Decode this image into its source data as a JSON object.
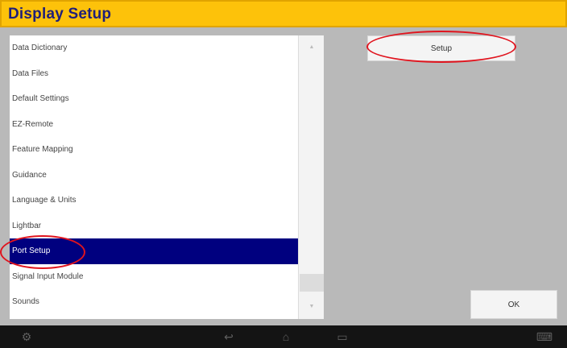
{
  "window": {
    "title": "Display Setup"
  },
  "list": {
    "items": [
      {
        "label": "Data Dictionary",
        "selected": false
      },
      {
        "label": "Data Files",
        "selected": false
      },
      {
        "label": "Default Settings",
        "selected": false
      },
      {
        "label": "EZ-Remote",
        "selected": false
      },
      {
        "label": "Feature Mapping",
        "selected": false
      },
      {
        "label": "Guidance",
        "selected": false
      },
      {
        "label": "Language & Units",
        "selected": false
      },
      {
        "label": "Lightbar",
        "selected": false
      },
      {
        "label": "Port Setup",
        "selected": true
      },
      {
        "label": "Signal Input Module",
        "selected": false
      },
      {
        "label": "Sounds",
        "selected": false
      }
    ],
    "scroll_up_icon": "triangle-up-icon",
    "scroll_down_icon": "triangle-down-icon"
  },
  "buttons": {
    "setup_label": "Setup",
    "ok_label": "OK"
  },
  "annotations": {
    "color": "#e0141e",
    "circled": [
      "Setup",
      "Port Setup"
    ]
  },
  "navbar": {
    "icons": [
      "settings-icon",
      "back-icon",
      "home-icon",
      "recents-icon",
      "keyboard-icon"
    ]
  },
  "colors": {
    "title_bar": "#fdc20a",
    "title_text": "#1f1f7a",
    "selection": "#00007f",
    "background": "#b9b9b9",
    "navbar": "#141414"
  }
}
